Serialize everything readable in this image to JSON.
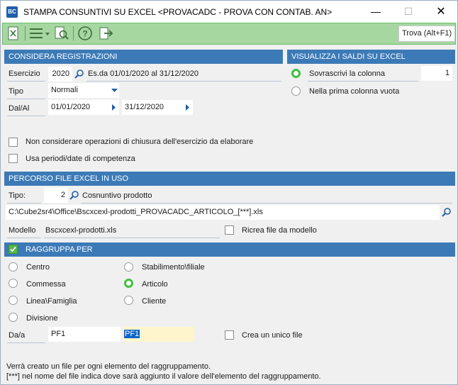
{
  "window": {
    "app_icon": "BC",
    "title": "STAMPA CONSUNTIVI SU EXCEL <PROVACADC - PROVA CON CONTAB. AN>",
    "min": "—",
    "max": "☐",
    "close": "✕"
  },
  "toolbar": {
    "icons": [
      "excel-icon",
      "menu-icon",
      "preview-icon",
      "help-icon",
      "exit-icon"
    ],
    "search_label": "Trova (Alt+F1)"
  },
  "considera": {
    "header": "CONSIDERA REGISTRAZIONI",
    "esercizio_label": "Esercizio",
    "esercizio_value": "2020",
    "esercizio_desc": "Es.da 01/01/2020 al 31/12/2020",
    "tipo_label": "Tipo",
    "tipo_value": "Normali",
    "dalal_label": "Dal/Al",
    "dal_value": "01/01/2020",
    "al_value": "31/12/2020",
    "chk_chiusura_label": "Non considerare operazioni di chiusura dell'esercizio da elaborare",
    "chk_competenza_label": "Usa periodi/date di competenza"
  },
  "visualizza": {
    "header": "VISUALIZZA I SALDI SU EXCEL",
    "opt1_label": "Sovrascrivi la colonna",
    "opt1_value": "1",
    "opt2_label": "Nella prima colonna vuota"
  },
  "percorso": {
    "header": "PERCORSO FILE EXCEL IN USO",
    "tipo_label": "Tipo:",
    "tipo_value": "2",
    "tipo_desc": "Cosnuntivo prodotto",
    "path": "C:\\Cube2sr4\\Office\\Bscxcexl-prodotti_PROVACADC_ARTICOLO_[***].xls",
    "modello_label": "Modello",
    "modello_value": "Bscxcexl-prodotti.xls",
    "ricrea_label": "Ricrea file da modello"
  },
  "raggruppa": {
    "header": "RAGGRUPPA PER",
    "options": [
      "Centro",
      "Stabilimento\\filiale",
      "Commessa",
      "Articolo",
      "Linea\\Famiglia",
      "Cliente",
      "Divisione"
    ],
    "selected": "Articolo",
    "daa_label": "Da/a",
    "da_value": "PF1",
    "a_value": "PF1",
    "unico_label": "Crea un unico file"
  },
  "notes": {
    "line1": "Verrà creato un file per ogni elemento del raggruppamento.",
    "line2": "[***] nel nome del file indica dove sarà aggiunto il valore dell'elemento del raggruppamento."
  }
}
